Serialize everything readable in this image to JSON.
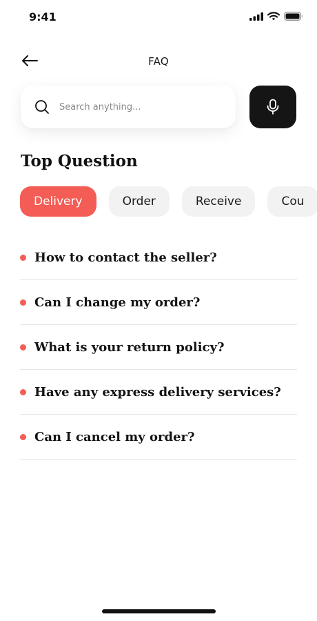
{
  "status_bar": {
    "time": "9:41"
  },
  "header": {
    "title": "FAQ"
  },
  "search": {
    "placeholder": "Search anything..."
  },
  "section": {
    "title": "Top Question"
  },
  "categories": [
    {
      "label": "Delivery",
      "active": true
    },
    {
      "label": "Order",
      "active": false
    },
    {
      "label": "Receive",
      "active": false
    },
    {
      "label": "Cou",
      "active": false
    }
  ],
  "questions": [
    "How to contact the seller?",
    "Can I change my order?",
    "What is your return policy?",
    "Have any express delivery services?",
    "Can I cancel my order?"
  ],
  "colors": {
    "accent": "#f35d55",
    "dark": "#151515",
    "chip_bg": "#f2f2f2"
  },
  "icons": {
    "back": "arrow-left-icon",
    "search": "search-icon",
    "mic": "microphone-icon"
  }
}
